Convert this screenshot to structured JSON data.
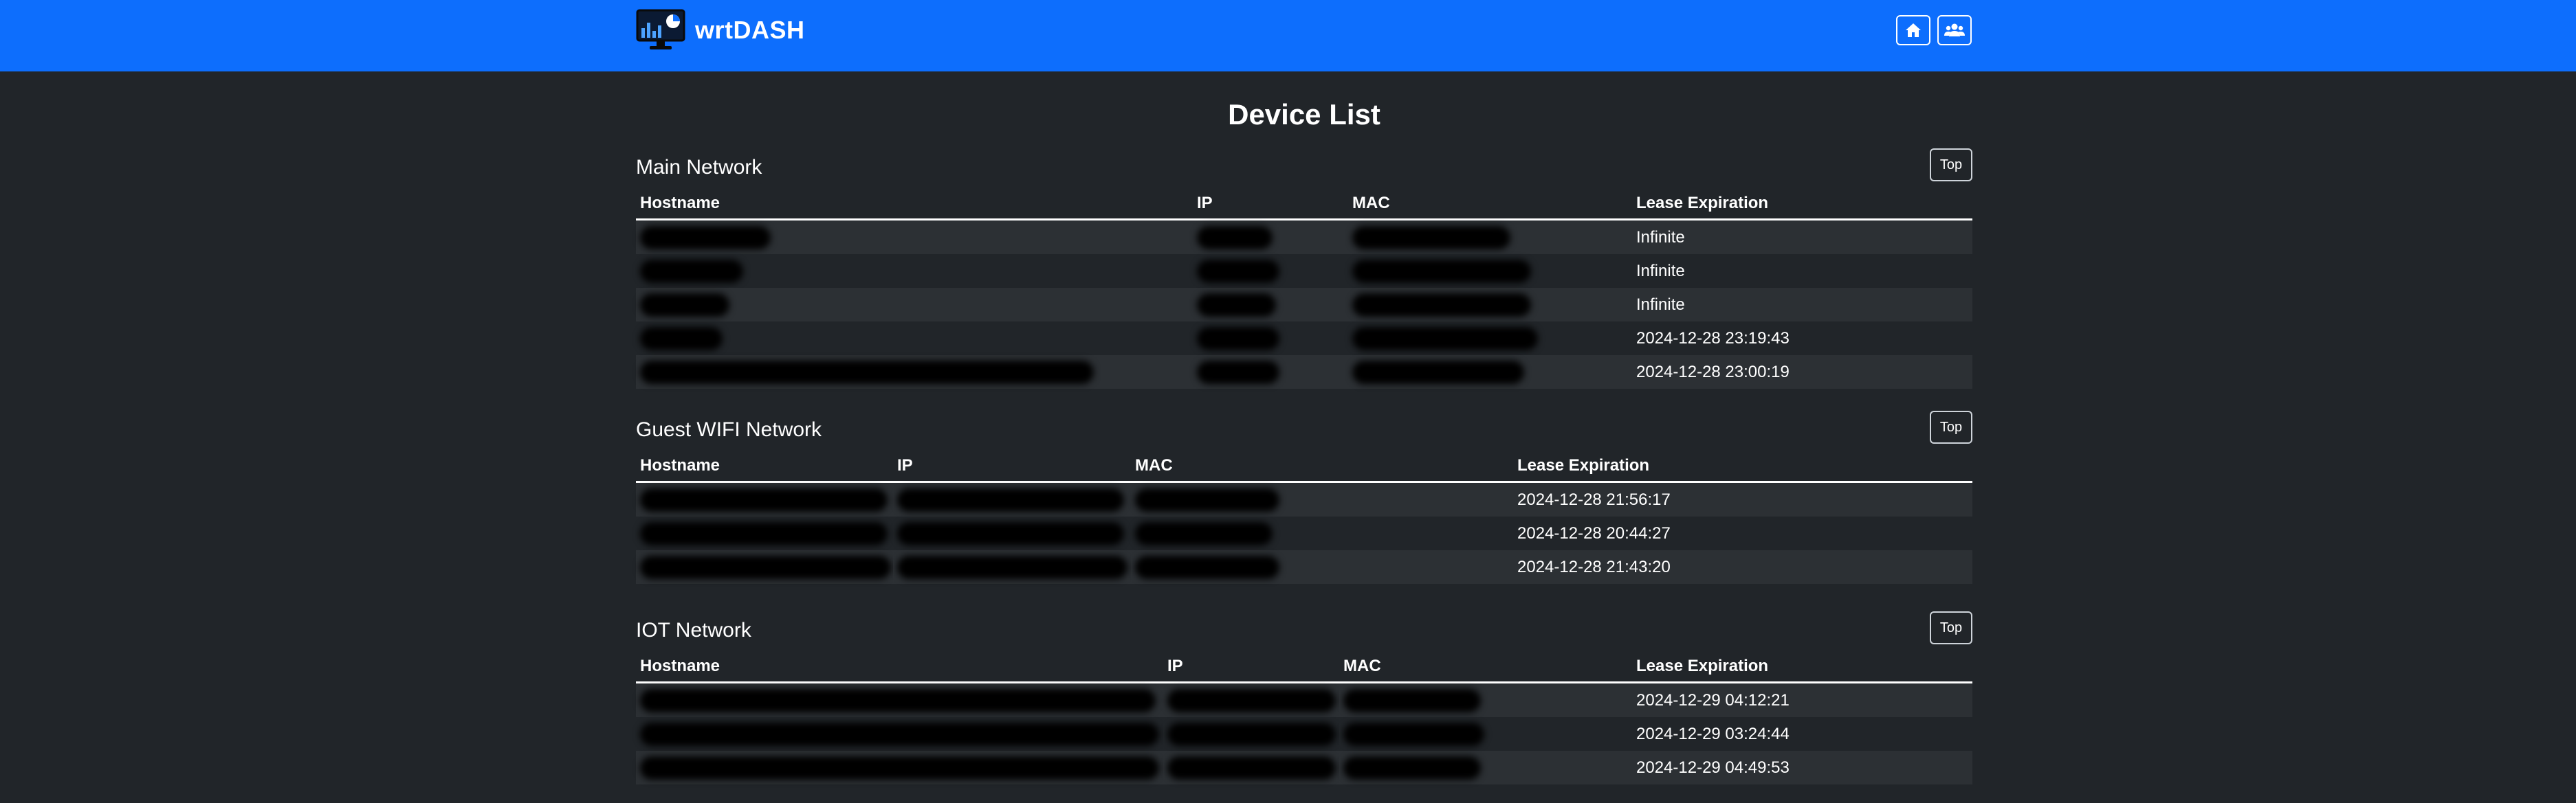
{
  "app": {
    "name": "wrtDASH"
  },
  "nav": {
    "home_icon": "home-icon",
    "users_icon": "users-icon"
  },
  "page": {
    "title": "Device List"
  },
  "columns": {
    "hostname": "Hostname",
    "ip": "IP",
    "mac": "MAC",
    "lease": "Lease Expiration"
  },
  "top_label": "Top",
  "main": {
    "title": "Main Network",
    "rows": [
      {
        "lease": "Infinite"
      },
      {
        "lease": "Infinite"
      },
      {
        "lease": "Infinite"
      },
      {
        "lease": "2024-12-28 23:19:43"
      },
      {
        "lease": "2024-12-28 23:00:19"
      }
    ]
  },
  "guest": {
    "title": "Guest WIFI Network",
    "rows": [
      {
        "lease": "2024-12-28 21:56:17"
      },
      {
        "lease": "2024-12-28 20:44:27"
      },
      {
        "lease": "2024-12-28 21:43:20"
      }
    ]
  },
  "iot": {
    "title": "IOT Network",
    "rows": [
      {
        "lease": "2024-12-29 04:12:21"
      },
      {
        "lease": "2024-12-29 03:24:44"
      },
      {
        "lease": "2024-12-29 04:49:53"
      }
    ]
  },
  "colors": {
    "navbar": "#0d6efd",
    "background": "#212529",
    "stripe": "#2c3034"
  }
}
